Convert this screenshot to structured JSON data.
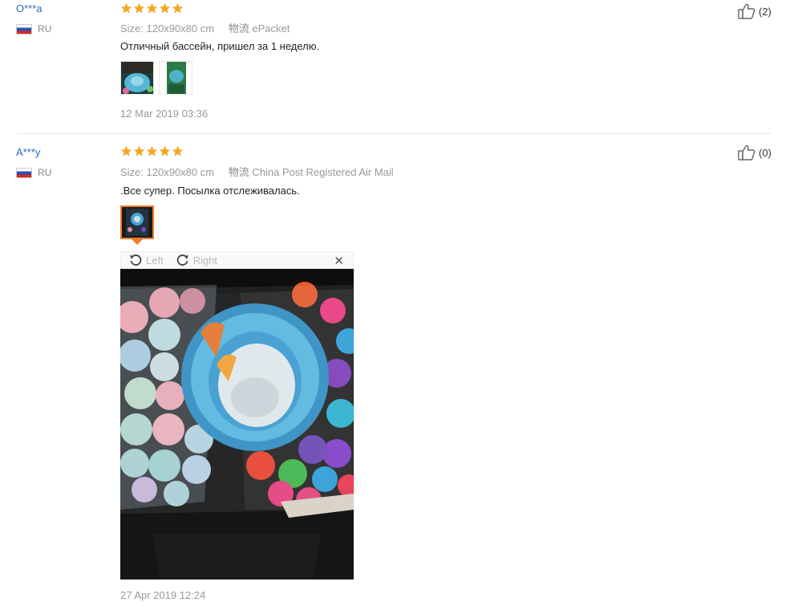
{
  "reviews": [
    {
      "user": "O***a",
      "country": "RU",
      "rating": 5,
      "size_label": "Size:",
      "size_value": "120x90x80 cm",
      "shipping_label": "物流",
      "shipping_value": "ePacket",
      "text": "Отличный бассейн, пришел за 1 неделю.",
      "images": 2,
      "date": "12 Mar 2019 03:36",
      "helpful_count": "(2)"
    },
    {
      "user": "A***y",
      "country": "RU",
      "rating": 5,
      "size_label": "Size:",
      "size_value": "120x90x80 cm",
      "shipping_label": "物流",
      "shipping_value": "China Post Registered Air Mail",
      "text": ".Все супер. Посылка отслеживалась.",
      "images": 1,
      "date": "27 Apr 2019 12:24",
      "helpful_count": "(0)"
    }
  ],
  "viewer": {
    "rotate_left": "Left",
    "rotate_right": "Right",
    "close_icon": "close-icon"
  },
  "colors": {
    "star": "#f5a623",
    "link": "#2a6bbf",
    "selected_border": "#f07a25"
  }
}
